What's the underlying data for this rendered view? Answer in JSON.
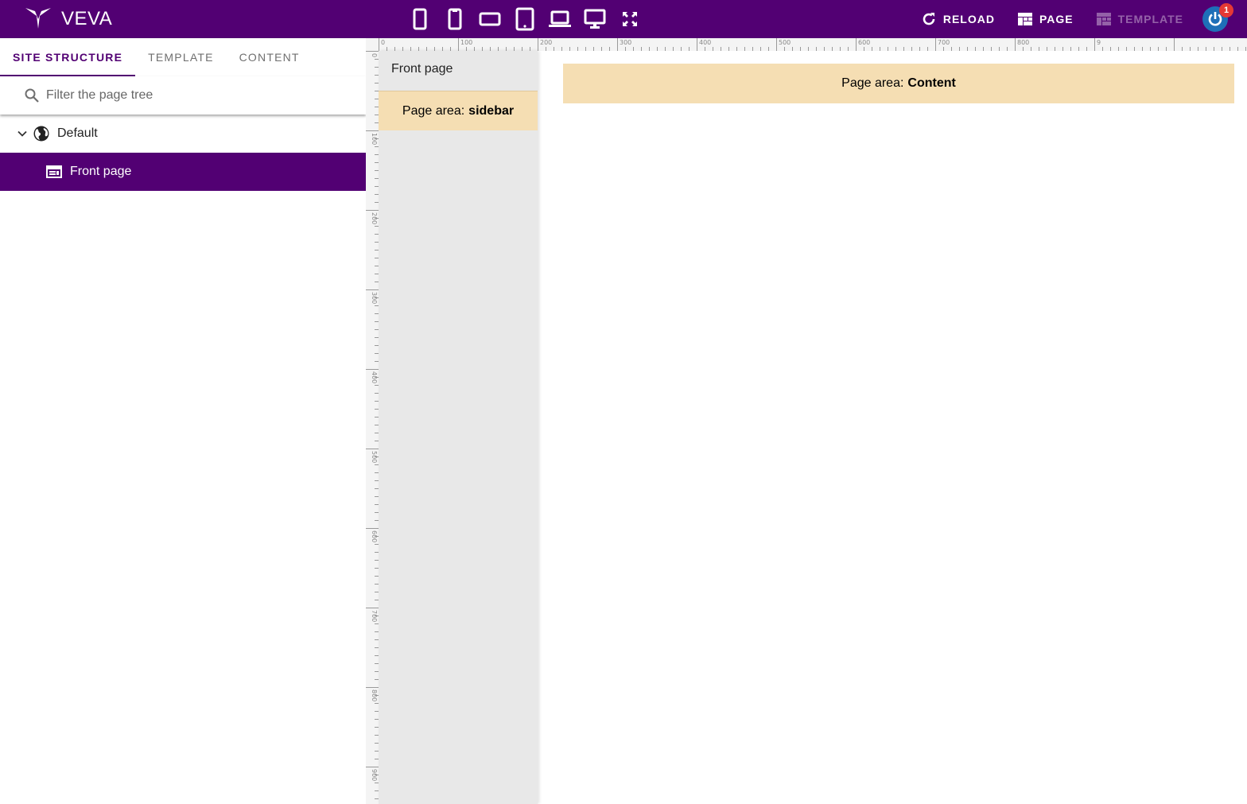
{
  "app": {
    "name": "VEVA",
    "brand_color": "#520073"
  },
  "device_buttons": [
    {
      "icon": "phone-small-icon"
    },
    {
      "icon": "phone-icon"
    },
    {
      "icon": "phone-landscape-icon"
    },
    {
      "icon": "tablet-icon"
    },
    {
      "icon": "laptop-icon"
    },
    {
      "icon": "desktop-icon"
    },
    {
      "icon": "fullscreen-icon"
    }
  ],
  "actions": {
    "reload": "RELOAD",
    "page": "PAGE",
    "template": "TEMPLATE"
  },
  "notification_count": "1",
  "tabs": [
    {
      "label": "SITE STRUCTURE",
      "active": true
    },
    {
      "label": "TEMPLATE",
      "active": false
    },
    {
      "label": "CONTENT",
      "active": false
    }
  ],
  "search": {
    "placeholder": "Filter the page tree",
    "value": ""
  },
  "tree": {
    "root": {
      "label": "Default",
      "icon": "globe-icon",
      "expanded": true
    },
    "children": [
      {
        "label": "Front page",
        "icon": "web-page-icon",
        "selected": true
      }
    ]
  },
  "ruler": {
    "top_labels": [
      "0",
      "100",
      "200",
      "300",
      "400",
      "500",
      "600",
      "700",
      "800",
      "9"
    ],
    "left_labels": [
      "0",
      "100",
      "200",
      "300",
      "400",
      "500",
      "600",
      "700",
      "800",
      "900"
    ]
  },
  "preview": {
    "sidebar_title": "Front page",
    "sidebar_area": {
      "prefix": "Page area:",
      "name": "sidebar"
    },
    "content_area": {
      "prefix": "Page area:",
      "name": "Content"
    },
    "area_color": "#f5deb3"
  }
}
